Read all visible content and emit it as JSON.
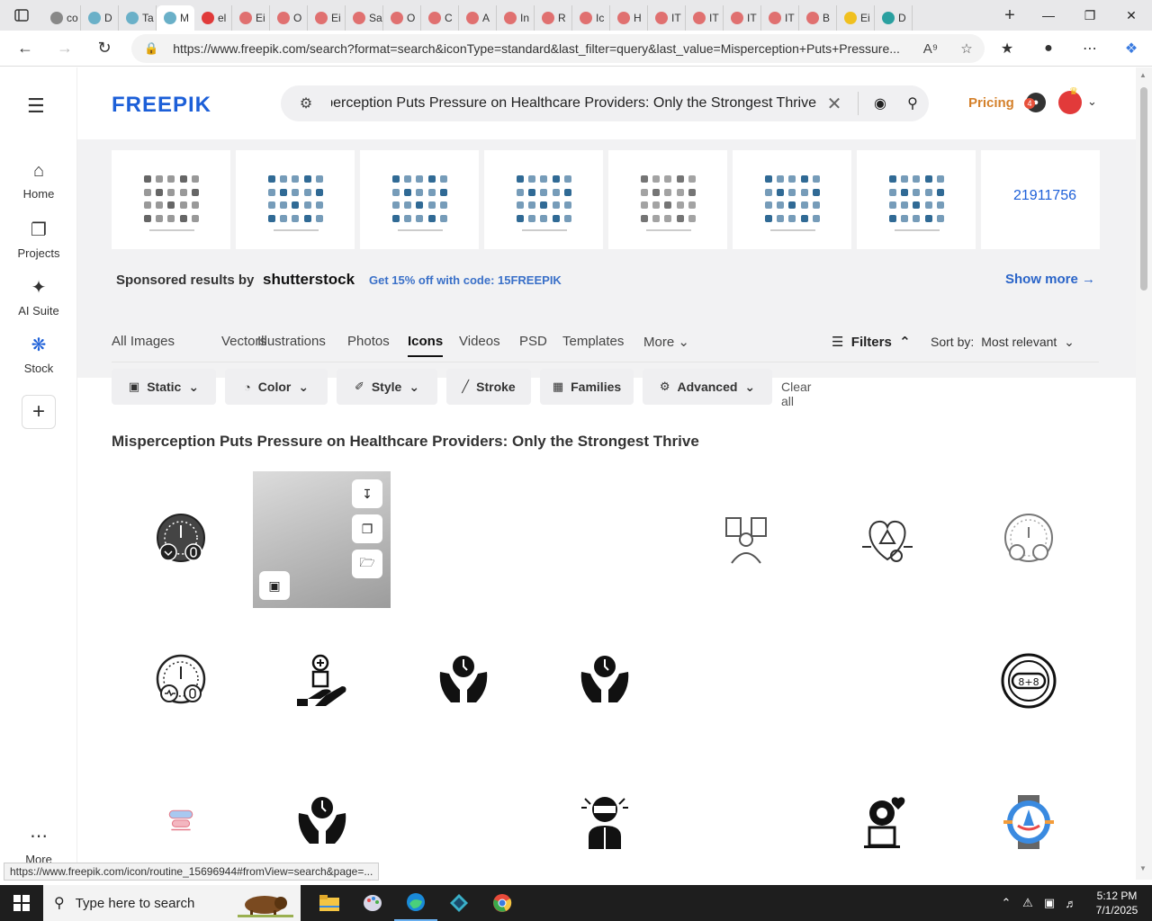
{
  "browser": {
    "tabs": [
      {
        "label": "co",
        "color": "#888888"
      },
      {
        "label": "D",
        "color": "#6ab0c8"
      },
      {
        "label": "Ta",
        "color": "#6ab0c8"
      },
      {
        "label": "M",
        "color": "#6ab0c8",
        "active": true
      },
      {
        "label": "el",
        "color": "#e03a3a"
      },
      {
        "label": "Ei",
        "color": "#e07070"
      },
      {
        "label": "O",
        "color": "#e07070"
      },
      {
        "label": "Ei",
        "color": "#e07070"
      },
      {
        "label": "Sa",
        "color": "#e07070"
      },
      {
        "label": "O",
        "color": "#e07070"
      },
      {
        "label": "C",
        "color": "#e07070"
      },
      {
        "label": "A",
        "color": "#e07070"
      },
      {
        "label": "In",
        "color": "#e07070"
      },
      {
        "label": "R",
        "color": "#e07070"
      },
      {
        "label": "Ic",
        "color": "#e07070"
      },
      {
        "label": "H",
        "color": "#e07070"
      },
      {
        "label": "IT",
        "color": "#e07070"
      },
      {
        "label": "IT",
        "color": "#e07070"
      },
      {
        "label": "IT",
        "color": "#e07070"
      },
      {
        "label": "IT",
        "color": "#e07070"
      },
      {
        "label": "B",
        "color": "#e07070"
      },
      {
        "label": "Ei",
        "color": "#f0c020"
      },
      {
        "label": "D",
        "color": "#2aa0a0"
      }
    ],
    "url": "https://www.freepik.com/search?format=search&iconType=standard&last_filter=query&last_value=Misperception+Puts+Pressure...",
    "status_url": "https://www.freepik.com/icon/routine_15696944#fromView=search&page=..."
  },
  "sidebar": {
    "items": [
      {
        "label": "Home",
        "icon": "home-icon"
      },
      {
        "label": "Projects",
        "icon": "projects-icon"
      },
      {
        "label": "AI Suite",
        "icon": "sparkle-icon"
      },
      {
        "label": "Stock",
        "icon": "stock-icon",
        "active": true
      }
    ],
    "more_label": "More"
  },
  "header": {
    "logo": "FREEPIK",
    "search_query": "Misperception Puts Pressure on Healthcare Providers: Only the Strongest Thrive",
    "pricing": "Pricing",
    "notif_count": "4"
  },
  "sponsored": {
    "label": "Sponsored results by",
    "brand": "shutterstock",
    "promo": "Get 15% off with code: 15FREEPIK",
    "show_more": "Show more →",
    "broken_image_alt": "21911756",
    "thumb_colors": [
      "#555555",
      "#1a5a8a",
      "#1a5a8a",
      "#1a5a8a",
      "#666666",
      "#1a5a8a",
      "#1a5a8a"
    ]
  },
  "categories": {
    "tabs": [
      "All Images",
      "Vectors",
      "Illustrations",
      "Photos",
      "Icons",
      "Videos",
      "PSD",
      "Templates",
      "More"
    ],
    "active": "Icons",
    "filters_label": "Filters",
    "sort_label": "Sort by:",
    "sort_value": "Most relevant"
  },
  "chips": {
    "items": [
      "Static",
      "Color",
      "Style",
      "Stroke",
      "Families",
      "Advanced"
    ],
    "clear_all": "Clear all"
  },
  "results": {
    "title": "Misperception Puts Pressure on Healthcare Providers: Only the Strongest Thrive"
  },
  "taskbar": {
    "search_placeholder": "Type here to search",
    "time": "5:12 PM",
    "date": "7/1/2025"
  }
}
